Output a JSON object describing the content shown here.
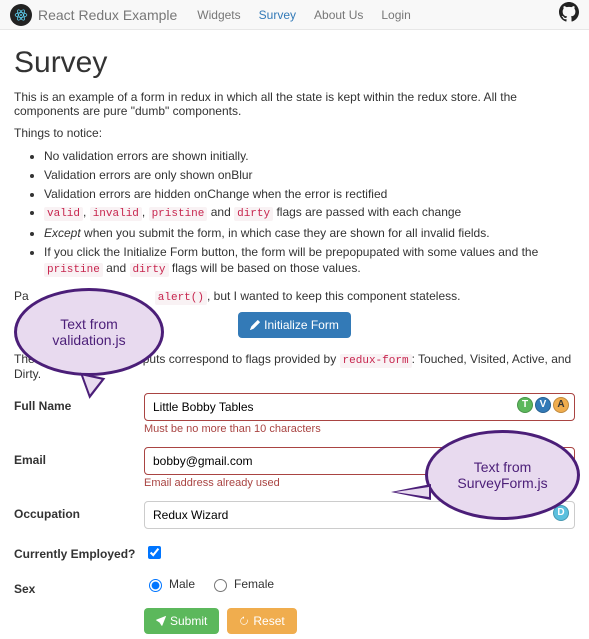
{
  "nav": {
    "brand": "React Redux Example",
    "links": [
      "Widgets",
      "Survey",
      "About Us",
      "Login"
    ],
    "activeIndex": 1
  },
  "page": {
    "title": "Survey",
    "intro": "This is an example of a form in redux in which all the state is kept within the redux store. All the components are pure \"dumb\" components.",
    "notice_heading": "Things to notice:",
    "bullets": {
      "b1": "No validation errors are shown initially.",
      "b2": "Validation errors are only shown onBlur",
      "b3": "Validation errors are hidden onChange when the error is rectified",
      "b4a": "valid",
      "b4b": "invalid",
      "b4c": "pristine",
      "b4d": "dirty",
      "b4txt1": ", ",
      "b4txt2": ", ",
      "b4txt3": " and ",
      "b4txt4": " flags are passed with each change",
      "b5a": "Except",
      "b5b": " when you submit the form, in which case they are shown for all invalid fields.",
      "b6a": "If you click the Initialize Form button, the form will be prepopupated with some values and the ",
      "b6b": "pristine",
      "b6c": " and ",
      "b6d": "dirty",
      "b6e": " flags will be based on those values."
    },
    "pardon_pre": "Pa",
    "pardon_code": "alert()",
    "pardon_post": ", but I wanted to keep this component stateless.",
    "initBtn": "Initialize Form",
    "legend_pre": "The ",
    "legend_mid": "e inputs correspond to flags provided by ",
    "legend_code": "redux-form",
    "legend_post": ": Touched, Visited, Active, and Dirty."
  },
  "form": {
    "name_label": "Full Name",
    "name_value": "Little Bobby Tables",
    "name_error": "Must be no more than 10 characters",
    "email_label": "Email",
    "email_value": "bobby@gmail.com",
    "email_error": "Email address already used",
    "occ_label": "Occupation",
    "occ_value": "Redux Wizard",
    "employed_label": "Currently Employed?",
    "employed_checked": true,
    "sex_label": "Sex",
    "sex_options": [
      "Male",
      "Female"
    ],
    "sex_selected": "Male",
    "submit": "Submit",
    "reset": "Reset"
  },
  "badges": {
    "t": "T",
    "v": "V",
    "a": "A",
    "d": "D"
  },
  "callouts": {
    "c1": "Text from validation.js",
    "c2": "Text from SurveyForm.js"
  }
}
